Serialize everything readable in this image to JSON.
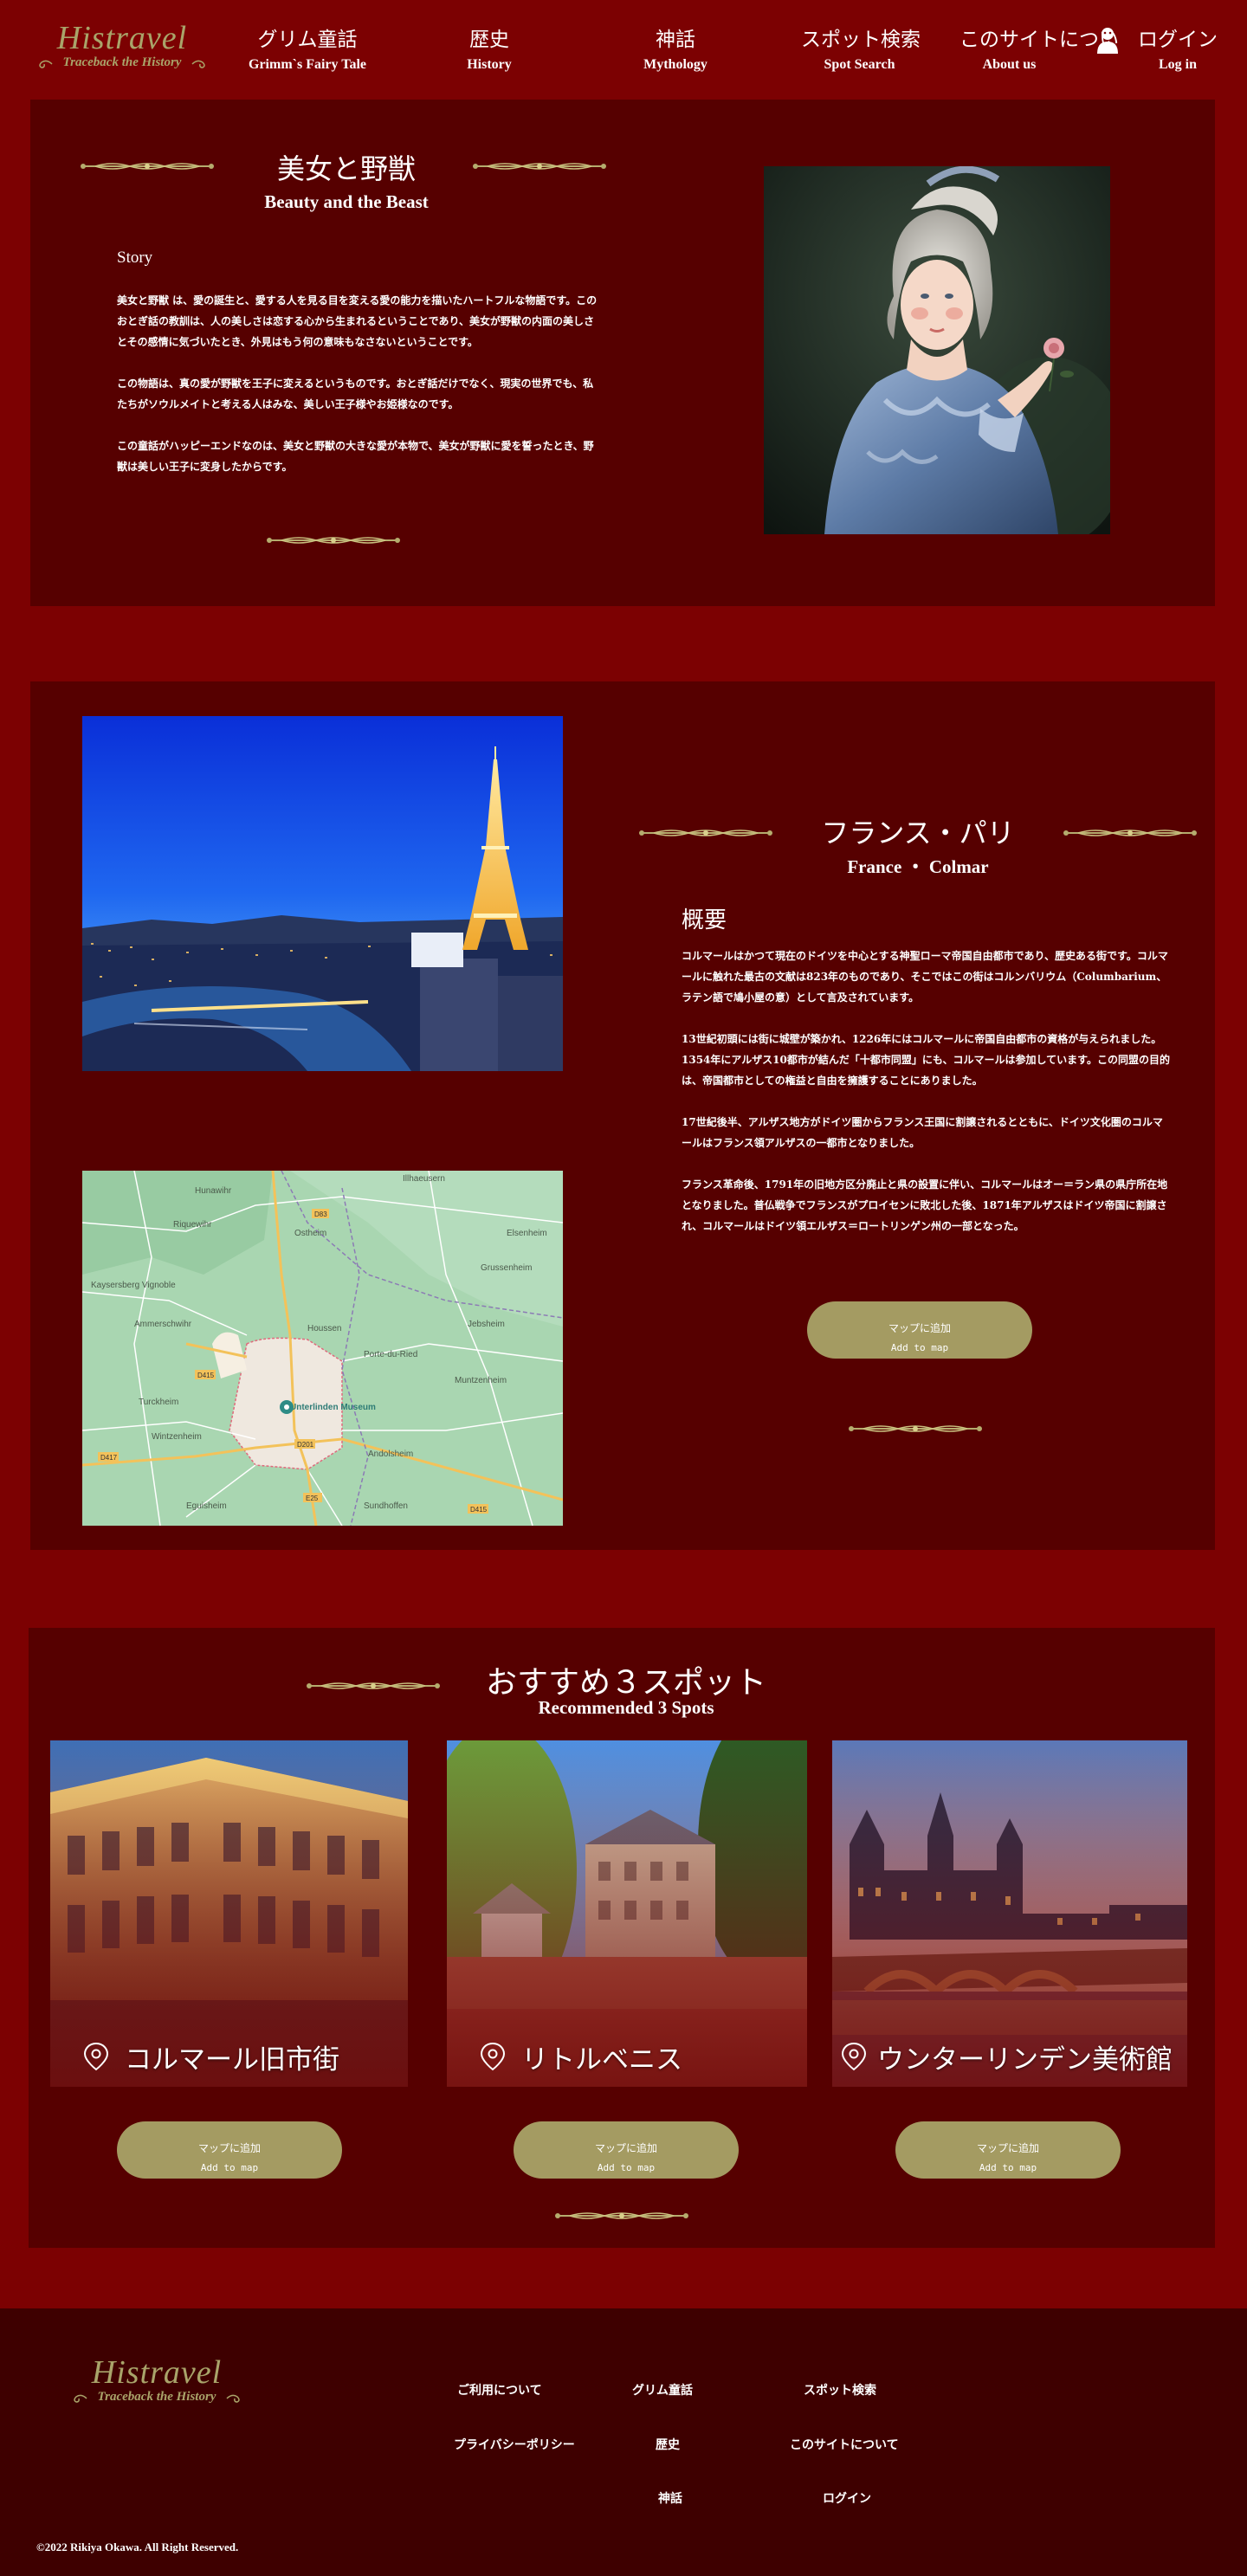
{
  "brand": {
    "name": "Histravel",
    "tagline": "Traceback the History"
  },
  "nav": [
    {
      "jp": "グリム童話",
      "en": "Grimm`s Fairy Tale"
    },
    {
      "jp": "歴史",
      "en": "History"
    },
    {
      "jp": "神話",
      "en": "Mythology"
    },
    {
      "jp": "スポット検索",
      "en": "Spot Search"
    },
    {
      "jp": "このサイトについ",
      "en": "About us"
    },
    {
      "jp": "ログイン",
      "en": "Log in"
    }
  ],
  "story": {
    "title_jp": "美女と野獣",
    "title_en": "Beauty and the Beast",
    "heading": "Story",
    "paragraphs": [
      "美女と野獣 は、愛の誕生と、愛する人を見る目を変える愛の能力を描いたハートフルな物語です。このおとぎ話の教訓は、人の美しさは恋する心から生まれるということであり、美女が野獣の内面の美しさとその感情に気づいたとき、外見はもう何の意味もなさないということです。",
      "この物語は、真の愛が野獣を王子に変えるというものです。おとぎ話だけでなく、現実の世界でも、私たちがソウルメイトと考える人はみな、美しい王子様やお姫様なのです。",
      "この童話がハッピーエンドなのは、美女と野獣の大きな愛が本物で、美女が野獣に愛を誓ったとき、野獣は美しい王子に変身したからです。"
    ]
  },
  "place": {
    "title_jp": "フランス・パリ",
    "title_en": "France ・ Colmar",
    "heading": "概要",
    "paragraphs": [
      "コルマールはかつて現在のドイツを中心とする神聖ローマ帝国自由都市であり、歴史ある街です。コルマールに触れた最古の文献は823年のものであり、そこではこの街はコルンバリウム（Columbarium、ラテン語で鳩小屋の意）として言及されています。",
      "13世紀初頭には街に城壁が築かれ、1226年にはコルマールに帝国自由都市の資格が与えられました。1354年にアルザス10都市が結んだ「十都市同盟」にも、コルマールは参加しています。この同盟の目的は、帝国都市としての権益と自由を擁護することにありました。",
      "17世紀後半、アルザス地方がドイツ圏からフランス王国に割譲されるとともに、ドイツ文化圏のコルマールはフランス領アルザスの一都市となりました。",
      "フランス革命後、1791年の旧地方区分廃止と県の設置に伴い、コルマールはオー＝ラン県の県庁所在地となりました。普仏戦争でフランスがプロイセンに敗北した後、1871年アルザスはドイツ帝国に割譲され、コルマールはドイツ領エルザス＝ロートリンゲン州の一部となった。"
    ],
    "btn_jp": "マップに追加",
    "btn_en": "Add to map",
    "map_labels": {
      "l1": "Hunawihr",
      "l2": "Illhaeusern",
      "l3": "Riquewihr",
      "l4": "Ostheim",
      "l5": "Kaysersberg Vignoble",
      "l6": "Ammerschwihr",
      "l7": "Houssen",
      "l8": "Grussenheim",
      "l9": "Elsenheim",
      "l10": "Jebsheim",
      "l11": "Porte-du-Ried",
      "l12": "Muntzenheim",
      "l13": "Turckheim",
      "l14": "Wintzenheim",
      "l15": "Unterlinden Museum",
      "l16": "Andolsheim",
      "l17": "Eguisheim",
      "l18": "Sundhoffen",
      "r1": "D415",
      "r2": "D83",
      "r3": "D417",
      "r4": "D201",
      "r5": "E25",
      "r6": "D415"
    }
  },
  "spots": {
    "title_jp": "おすすめ３スポット",
    "title_en": "Recommended 3 Spots",
    "items": [
      {
        "name": "コルマール旧市街",
        "btn_jp": "マップに追加",
        "btn_en": "Add to map"
      },
      {
        "name": "リトルベニス",
        "btn_jp": "マップに追加",
        "btn_en": "Add to map"
      },
      {
        "name": "ウンターリンデン美術館",
        "btn_jp": "マップに追加",
        "btn_en": "Add to map"
      }
    ]
  },
  "footer": {
    "links": {
      "terms": "ご利用について",
      "privacy": "プライバシーポリシー",
      "grimm": "グリム童話",
      "history": "歴史",
      "mythology": "神話",
      "spot": "スポット検索",
      "about": "このサイトについて",
      "login": "ログイン"
    },
    "copyright": "©2022 Rikiya Okawa. All Right Reserved."
  },
  "colors": {
    "page_bg": "#7c0102",
    "panel_bg": "#560000",
    "footer_bg": "#3e0000",
    "accent_gold": "#a9a46a",
    "button": "#a49b62"
  }
}
